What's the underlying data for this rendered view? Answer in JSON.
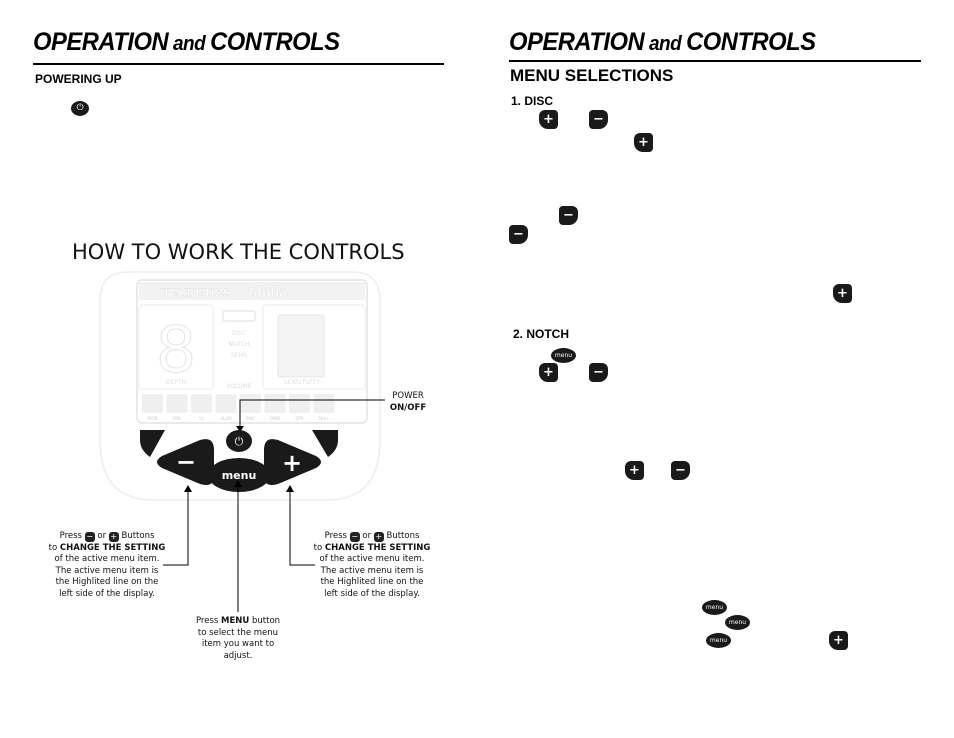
{
  "left": {
    "title_main": "OPERATION",
    "title_and": " and ",
    "title_end": "CONTROLS",
    "powering_up": "POWERING UP",
    "how_to": "HOW TO WORK THE CONTROLS",
    "device": {
      "brand": "TEKNETICS",
      "model": "Alpha",
      "digit": "8",
      "depth": "DEPTH",
      "menu_items": [
        "DISC",
        "NOTCH",
        "SENS"
      ],
      "volume": "VOLUME",
      "sensitivity": "SENSITIVITY",
      "target_labels": [
        "IRON",
        "FOIL",
        "5¢",
        "ALUM",
        "ZINC",
        "DIME",
        "QTR",
        "50¢+"
      ],
      "menu_button": "menu",
      "plus": "+",
      "minus": "−"
    },
    "power_label": "POWER",
    "power_onoff": "ON/OFF",
    "callout_left": {
      "press": "Press",
      "or": "or",
      "buttons": "Buttons",
      "to": "to",
      "change": "CHANGE THE SETTING",
      "rest": "of the active menu item. The active menu item is the Highlited line on the left side of the display."
    },
    "callout_right": {
      "press": "Press",
      "or": "or",
      "buttons": "Buttons",
      "to": "to",
      "change": "CHANGE THE SETTING",
      "rest": "of the active menu item. The active menu item is the Highlited line on the left side of the display."
    },
    "callout_menu": {
      "press": "Press",
      "menu": "MENU",
      "rest1": "button",
      "rest2": "to select the menu item you want to adjust."
    }
  },
  "right": {
    "title_main": "OPERATION",
    "title_and": " and ",
    "title_end": "CONTROLS",
    "menu_selections": "MENU SELECTIONS",
    "disc": "1. DISC",
    "notch": "2. NOTCH",
    "plus": "+",
    "minus": "−",
    "menu": "menu"
  }
}
